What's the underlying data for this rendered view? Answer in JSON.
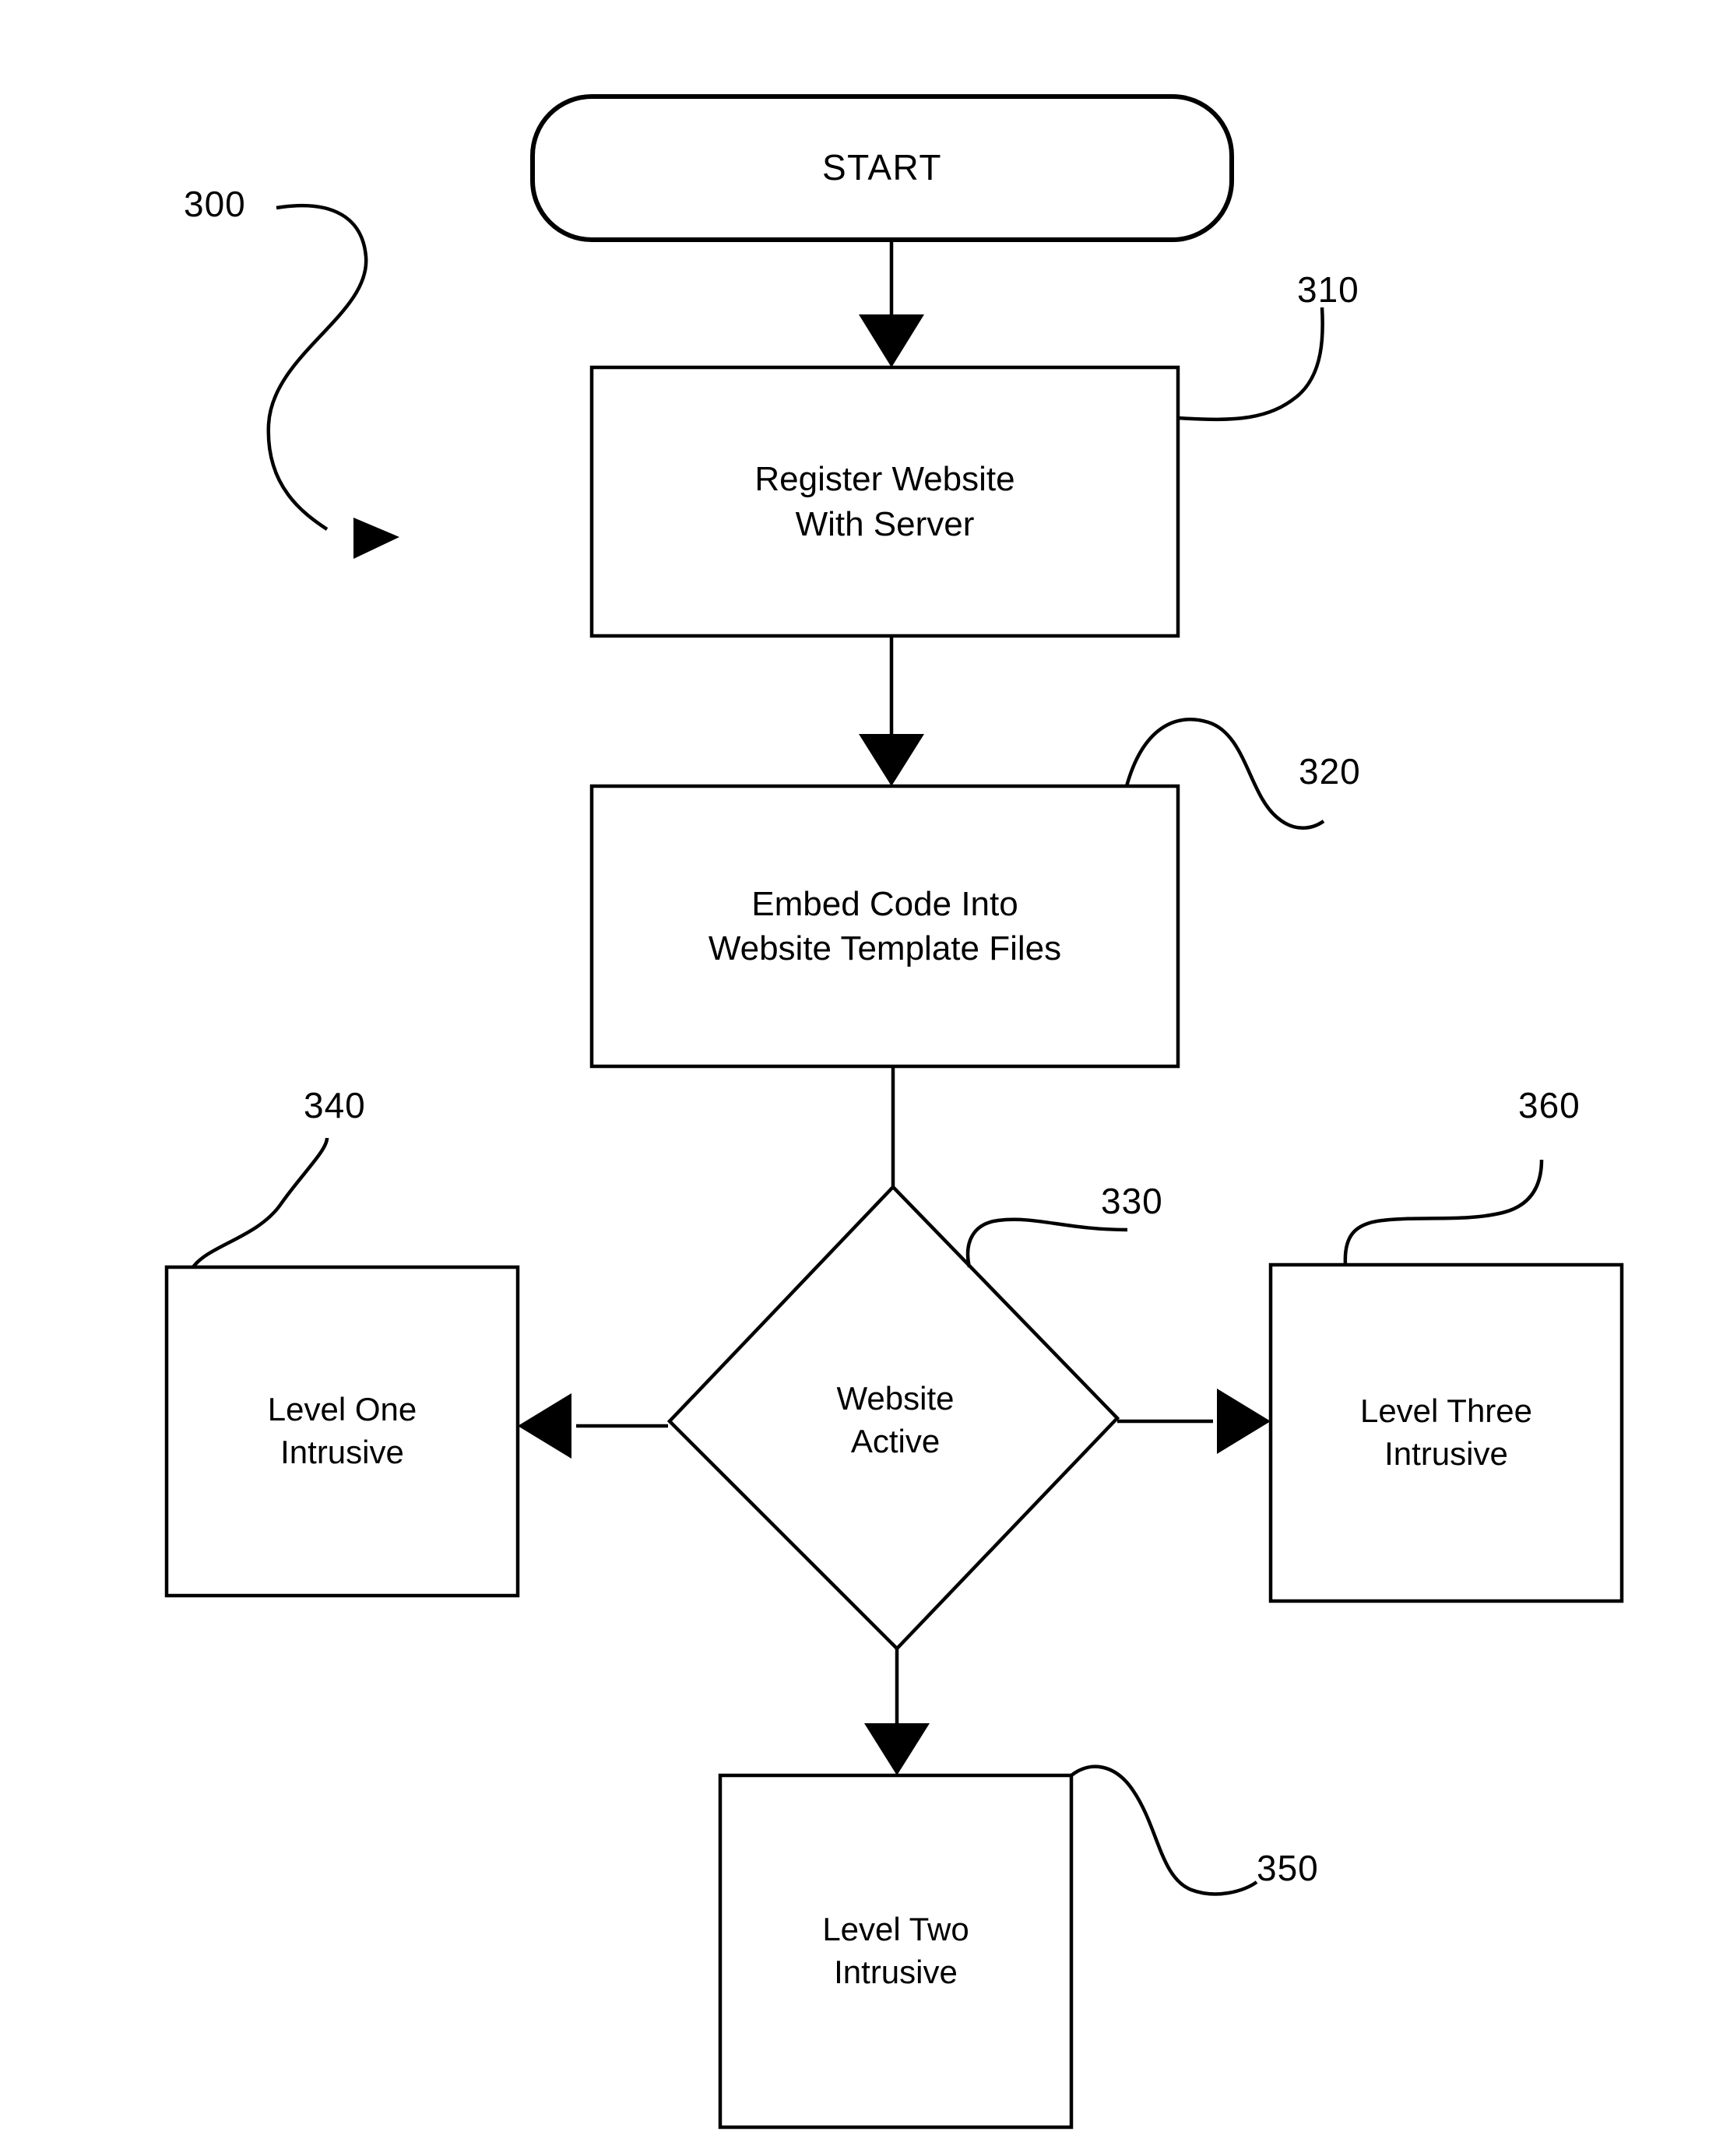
{
  "figure": {
    "type": "flowchart",
    "reference_numeral": "300",
    "nodes": [
      {
        "id": "start",
        "shape": "terminator",
        "label": "START",
        "lines": [
          "START"
        ],
        "ref": null
      },
      {
        "id": "register",
        "shape": "process",
        "label": "Register Website With Server",
        "lines": [
          "Register Website",
          "With Server"
        ],
        "ref": "310"
      },
      {
        "id": "embed",
        "shape": "process",
        "label": "Embed Code Into Website Template Files",
        "lines": [
          "Embed Code Into",
          "Website Template Files"
        ],
        "ref": "320"
      },
      {
        "id": "decision",
        "shape": "decision",
        "label": "Website Active",
        "lines": [
          "Website",
          "Active"
        ],
        "ref": "330"
      },
      {
        "id": "level_one",
        "shape": "process",
        "label": "Level One Intrusive",
        "lines": [
          "Level One",
          "Intrusive"
        ],
        "ref": "340"
      },
      {
        "id": "level_two",
        "shape": "process",
        "label": "Level Two Intrusive",
        "lines": [
          "Level Two",
          "Intrusive"
        ],
        "ref": "350"
      },
      {
        "id": "level_three",
        "shape": "process",
        "label": "Level Three Intrusive",
        "lines": [
          "Level Three",
          "Intrusive"
        ],
        "ref": "360"
      }
    ],
    "edges": [
      {
        "from": "start",
        "to": "register",
        "direction": "down"
      },
      {
        "from": "register",
        "to": "embed",
        "direction": "down"
      },
      {
        "from": "embed",
        "to": "decision",
        "direction": "down"
      },
      {
        "from": "decision",
        "to": "level_one",
        "direction": "left"
      },
      {
        "from": "decision",
        "to": "level_three",
        "direction": "right"
      },
      {
        "from": "decision",
        "to": "level_two",
        "direction": "down"
      }
    ],
    "reference_numerals": [
      "300",
      "310",
      "320",
      "330",
      "340",
      "350",
      "360"
    ],
    "colors": {
      "stroke": "#000000",
      "fill": "#ffffff",
      "text": "#000000"
    }
  }
}
